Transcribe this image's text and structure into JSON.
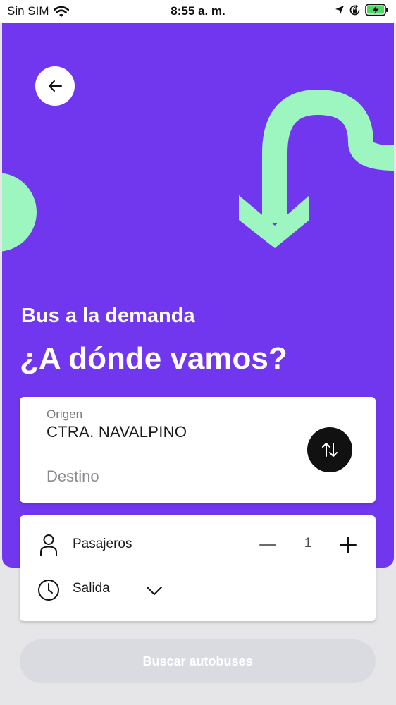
{
  "status_bar": {
    "carrier": "Sin SIM",
    "time": "8:55 a. m.",
    "icons": [
      "wifi-icon",
      "location-arrow-icon",
      "orientation-lock-icon",
      "battery-charging-icon"
    ]
  },
  "hero": {
    "subtitle": "Bus a la demanda",
    "title": "¿A dónde vamos?",
    "background_color": "#7137ef",
    "accent_color": "#9df5c0"
  },
  "route": {
    "origin_label": "Origen",
    "origin_value": "CTRA. NAVALPINO",
    "destination_placeholder": "Destino"
  },
  "options": {
    "passengers_label": "Pasajeros",
    "passengers_count": "1",
    "departure_label": "Salida"
  },
  "search_button_label": "Buscar autobuses"
}
